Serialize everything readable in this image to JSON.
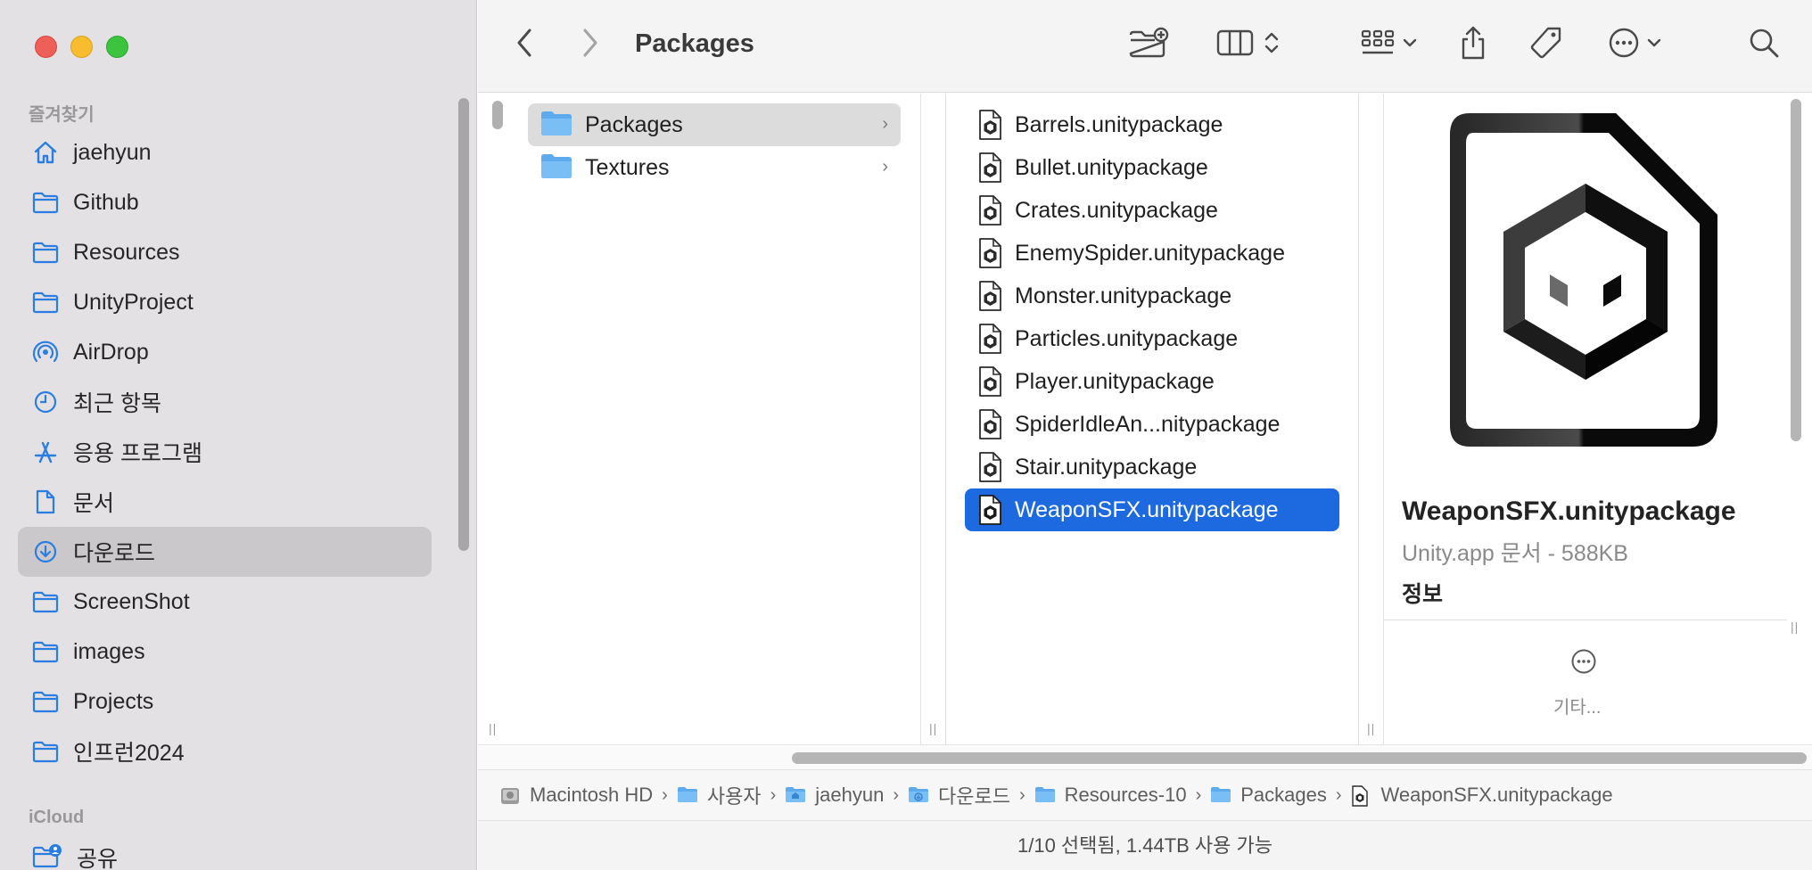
{
  "window": {
    "title": "Packages"
  },
  "sidebar": {
    "favorites_title": "즐겨찾기",
    "items": [
      {
        "label": "jaehyun",
        "icon": "home-icon"
      },
      {
        "label": "Github",
        "icon": "folder-icon"
      },
      {
        "label": "Resources",
        "icon": "folder-icon"
      },
      {
        "label": "UnityProject",
        "icon": "folder-icon"
      },
      {
        "label": "AirDrop",
        "icon": "airdrop-icon"
      },
      {
        "label": "최근 항목",
        "icon": "clock-icon"
      },
      {
        "label": "응용 프로그램",
        "icon": "apps-icon"
      },
      {
        "label": "문서",
        "icon": "document-icon"
      },
      {
        "label": "다운로드",
        "icon": "download-icon",
        "selected": true
      },
      {
        "label": "ScreenShot",
        "icon": "folder-icon"
      },
      {
        "label": "images",
        "icon": "folder-icon"
      },
      {
        "label": "Projects",
        "icon": "folder-icon"
      },
      {
        "label": "인프런2024",
        "icon": "folder-icon"
      }
    ],
    "icloud_title": "iCloud",
    "icloud_items": [
      {
        "label": "공유",
        "icon": "shared-folder-icon"
      }
    ]
  },
  "toolbar": {
    "icons": [
      "back-icon",
      "forward-icon",
      "new-folder-icon",
      "column-view-icon",
      "group-icon",
      "share-icon",
      "tag-icon",
      "more-actions-icon",
      "search-icon"
    ]
  },
  "column1": {
    "items": [
      {
        "name": "Packages",
        "selected": true
      },
      {
        "name": "Textures",
        "selected": false
      }
    ]
  },
  "column2": {
    "items": [
      {
        "name": "Barrels.unitypackage"
      },
      {
        "name": "Bullet.unitypackage"
      },
      {
        "name": "Crates.unitypackage"
      },
      {
        "name": "EnemySpider.unitypackage"
      },
      {
        "name": "Monster.unitypackage"
      },
      {
        "name": "Particles.unitypackage"
      },
      {
        "name": "Player.unitypackage"
      },
      {
        "name": "SpiderIdleAn...nitypackage"
      },
      {
        "name": "Stair.unitypackage"
      },
      {
        "name": "WeaponSFX.unitypackage",
        "selected": true
      }
    ]
  },
  "preview": {
    "title": "WeaponSFX.unitypackage",
    "subtitle": "Unity.app 문서 - 588KB",
    "info_label": "정보",
    "more_label": "기타..."
  },
  "pathbar": {
    "crumbs": [
      {
        "label": "Macintosh HD",
        "icon": "disk-icon"
      },
      {
        "label": "사용자",
        "icon": "folder-icon"
      },
      {
        "label": "jaehyun",
        "icon": "home-folder-icon"
      },
      {
        "label": "다운로드",
        "icon": "download-folder-icon"
      },
      {
        "label": "Resources-10",
        "icon": "folder-icon"
      },
      {
        "label": "Packages",
        "icon": "folder-icon"
      },
      {
        "label": "WeaponSFX.unitypackage",
        "icon": "unity-file-icon"
      }
    ]
  },
  "status": {
    "text": "1/10 선택됨, 1.44TB 사용 가능"
  },
  "colors": {
    "accent": "#1d6ae0",
    "sidebar_bg": "#e4e1e4",
    "folder_blue": "#6cb7f2"
  }
}
